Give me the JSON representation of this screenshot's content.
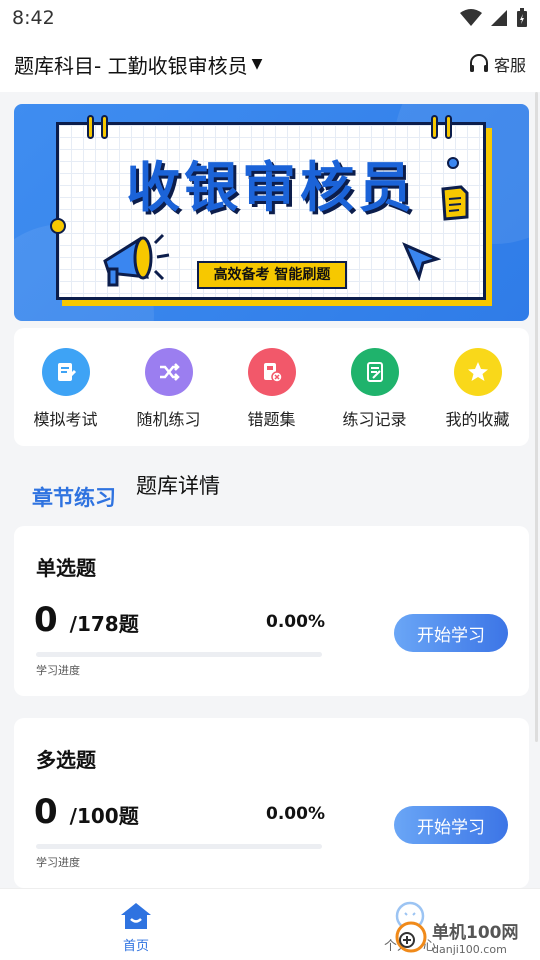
{
  "status_bar": {
    "time": "8:42"
  },
  "header": {
    "title": "题库科目- 工勤收银审核员",
    "service_label": "客服"
  },
  "banner": {
    "title": "收银审核员",
    "tag": "高效备考 智能刷题"
  },
  "quick_actions": [
    {
      "label": "模拟考试",
      "icon": "exam-icon",
      "color": "#3ea3f5"
    },
    {
      "label": "随机练习",
      "icon": "shuffle-icon",
      "color": "#9b7ef0"
    },
    {
      "label": "错题集",
      "icon": "wrong-set-icon",
      "color": "#f2586a"
    },
    {
      "label": "练习记录",
      "icon": "record-icon",
      "color": "#1fb36c"
    },
    {
      "label": "我的收藏",
      "icon": "star-icon",
      "color": "#f9d81a"
    }
  ],
  "tabs": {
    "active": "章节练习",
    "other": "题库详情"
  },
  "sections": [
    {
      "title": "单选题",
      "done": "0",
      "total": "/178题",
      "percent": "0.00%",
      "progress": 0,
      "progress_label": "学习进度",
      "button": "开始学习"
    },
    {
      "title": "多选题",
      "done": "0",
      "total": "/100题",
      "percent": "0.00%",
      "progress": 0,
      "progress_label": "学习进度",
      "button": "开始学习"
    }
  ],
  "bottom_nav": {
    "home": "首页",
    "me": "个人中心"
  },
  "watermark": {
    "cn": "单机100网",
    "en": "danji100.com"
  },
  "colors": {
    "accent": "#2f73e0",
    "banner": "#3f8df0",
    "yellow": "#f7c800"
  }
}
